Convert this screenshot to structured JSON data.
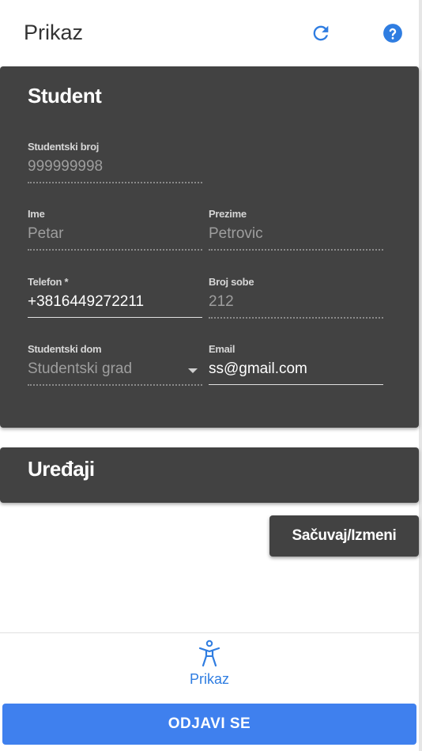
{
  "header": {
    "title": "Prikaz",
    "refresh_icon": "refresh-icon",
    "help_icon": "help-icon"
  },
  "student_panel": {
    "title": "Student",
    "expanded": true,
    "fields": {
      "student_number": {
        "label": "Studentski broj",
        "value": "999999998"
      },
      "first_name": {
        "label": "Ime",
        "value": "Petar"
      },
      "last_name": {
        "label": "Prezime",
        "value": "Petrovic"
      },
      "phone": {
        "label": "Telefon *",
        "value": "+3816449272211"
      },
      "room": {
        "label": "Broj sobe",
        "value": "212"
      },
      "dorm": {
        "label": "Studentski dom",
        "value": "Studentski grad"
      },
      "email": {
        "label": "Email",
        "value": "ss@gmail.com"
      }
    }
  },
  "devices_panel": {
    "title": "Uređaji",
    "expanded": false
  },
  "save_button": {
    "label": "Sačuvaj/Izmeni"
  },
  "bottom_nav": {
    "items": [
      {
        "label": "Prikaz",
        "icon": "accessibility-icon",
        "active": true
      }
    ]
  },
  "logout_button": {
    "label": "ODJAVI SE"
  },
  "colors": {
    "accent": "#2f7de1",
    "panel": "#424242",
    "logout": "#3f80ee"
  }
}
